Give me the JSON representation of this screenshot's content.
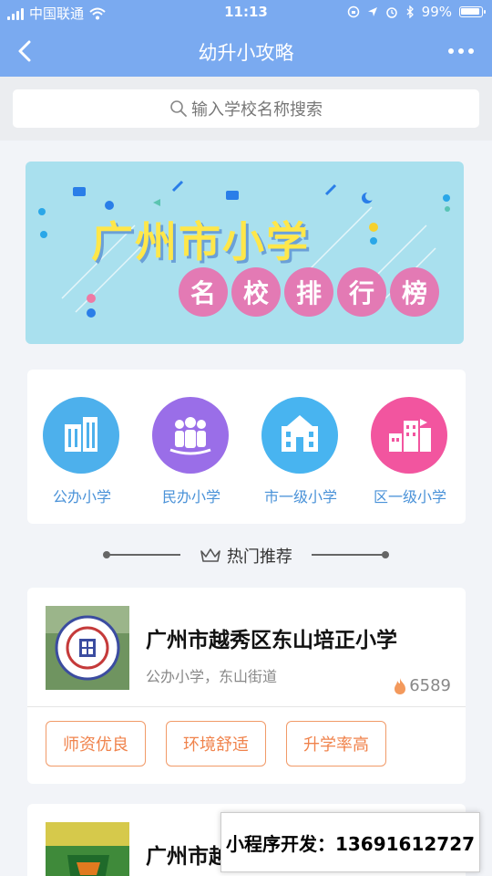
{
  "status_bar": {
    "carrier": "中国联通",
    "time": "11:13",
    "battery": "99%"
  },
  "nav": {
    "title": "幼升小攻略"
  },
  "search": {
    "placeholder": "输入学校名称搜索"
  },
  "banner": {
    "title": "广州市小学",
    "subtitle_chars": [
      "名",
      "校",
      "排",
      "行",
      "榜"
    ]
  },
  "categories": [
    {
      "label": "公办小学",
      "icon": "buildings-icon",
      "color": "#4db0ec"
    },
    {
      "label": "民办小学",
      "icon": "people-icon",
      "color": "#9a6ee8"
    },
    {
      "label": "市一级小学",
      "icon": "school-icon",
      "color": "#48b4f0"
    },
    {
      "label": "区一级小学",
      "icon": "city-icon",
      "color": "#f2559f"
    }
  ],
  "hot_section": {
    "title": "热门推荐"
  },
  "schools": [
    {
      "name": "广州市越秀区东山培正小学",
      "meta": "公办小学，东山街道",
      "heat": "6589",
      "tags": [
        "师资优良",
        "环境舒适",
        "升学率高"
      ]
    },
    {
      "name": "广州市越秀区"
    }
  ],
  "developer_ad": {
    "text": "小程序开发：13691612727"
  },
  "colors": {
    "nav_bg": "#7aaaf0",
    "accent_orange": "#f0834c",
    "category_label": "#4a92d8"
  }
}
